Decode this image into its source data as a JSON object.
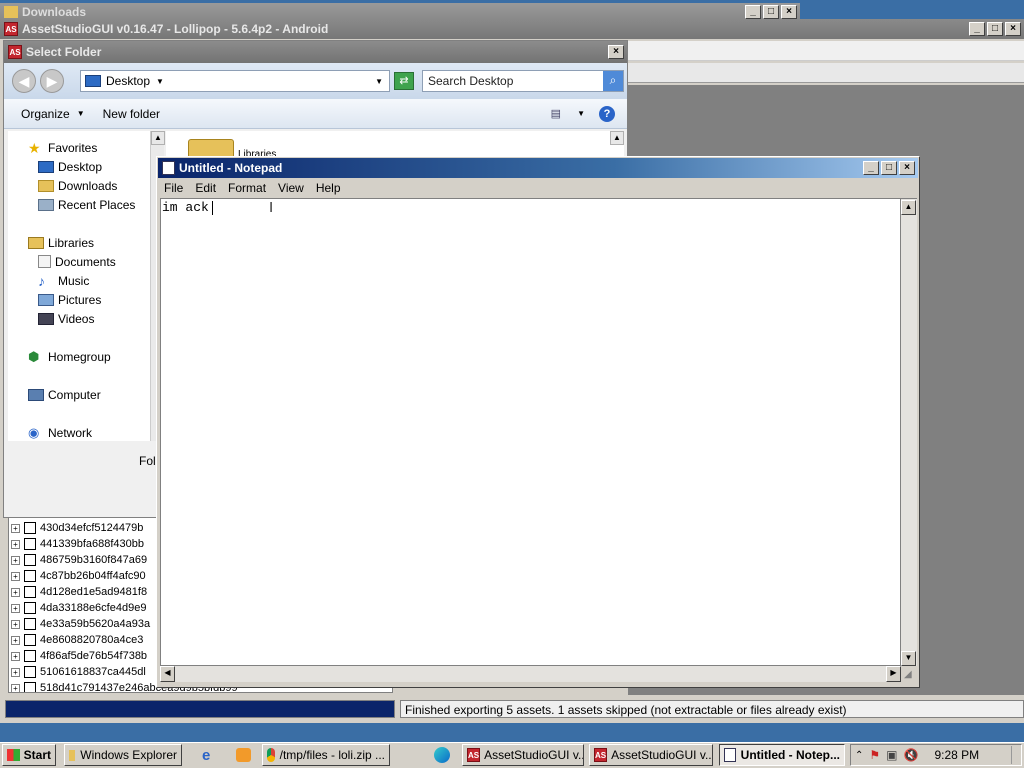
{
  "downloads_window": {
    "title": "Downloads"
  },
  "asset_studio": {
    "title": "AssetStudioGUI v0.16.47 - Lollipop - 5.6.4p2 - Android",
    "status": "Finished exporting 5 assets.  1 assets skipped (not extractable or files already exist)",
    "tree_items": [
      "430d34efcf5124479b",
      "441339bfa688f430bb",
      "486759b3160f847a69",
      "4c87bb26b04ff4afc90",
      "4d128ed1e5ad9481f8",
      "4da33188e6cfe4d9e9",
      "4e33a59b5620a4a93a",
      "4e8608820780a4ce3",
      "4f86af5de76b54f738b",
      "51061618837ca445dl",
      "518d41c791437e246abcea9d9b5bfdb99"
    ],
    "progress": 1.0
  },
  "select_folder": {
    "title": "Select Folder",
    "location": "Desktop",
    "search_placeholder": "Search Desktop",
    "toolbar": {
      "organize": "Organize",
      "new_folder": "New folder"
    },
    "nav": {
      "favorites": "Favorites",
      "desktop": "Desktop",
      "downloads": "Downloads",
      "recent": "Recent Places",
      "libraries": "Libraries",
      "documents": "Documents",
      "music": "Music",
      "pictures": "Pictures",
      "videos": "Videos",
      "homegroup": "Homegroup",
      "computer": "Computer",
      "network": "Network"
    },
    "content_item": "Libraries",
    "folder_label_partial": "Fol"
  },
  "notepad": {
    "title": "Untitled - Notepad",
    "menu": {
      "file": "File",
      "edit": "Edit",
      "format": "Format",
      "view": "View",
      "help": "Help"
    },
    "content": "im ack"
  },
  "taskbar": {
    "start": "Start",
    "items": {
      "explorer": "Windows Explorer",
      "chrome": "/tmp/files - loli.zip ...",
      "asset1": "AssetStudioGUI v...",
      "asset2": "AssetStudioGUI v...",
      "notepad": "Untitled - Notep..."
    },
    "clock": "9:28 PM"
  },
  "colors": {
    "titlebar_active": "#0a246a",
    "desktop": "#3a6ea5",
    "progress": "#0a246a"
  }
}
